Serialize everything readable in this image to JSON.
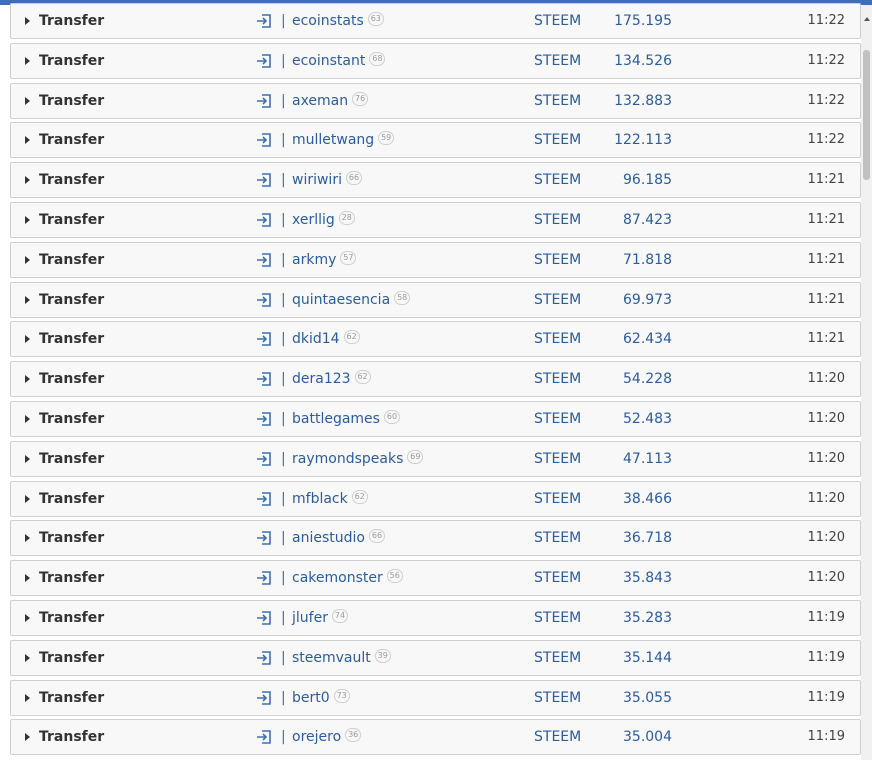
{
  "rows": [
    {
      "op": "Transfer",
      "user": "ecoinstats",
      "rep": "63",
      "asset": "STEEM",
      "amount": "175.195",
      "time": "11:22"
    },
    {
      "op": "Transfer",
      "user": "ecoinstant",
      "rep": "68",
      "asset": "STEEM",
      "amount": "134.526",
      "time": "11:22"
    },
    {
      "op": "Transfer",
      "user": "axeman",
      "rep": "76",
      "asset": "STEEM",
      "amount": "132.883",
      "time": "11:22"
    },
    {
      "op": "Transfer",
      "user": "mulletwang",
      "rep": "59",
      "asset": "STEEM",
      "amount": "122.113",
      "time": "11:22"
    },
    {
      "op": "Transfer",
      "user": "wiriwiri",
      "rep": "66",
      "asset": "STEEM",
      "amount": "96.185",
      "time": "11:21"
    },
    {
      "op": "Transfer",
      "user": "xerllig",
      "rep": "28",
      "asset": "STEEM",
      "amount": "87.423",
      "time": "11:21"
    },
    {
      "op": "Transfer",
      "user": "arkmy",
      "rep": "57",
      "asset": "STEEM",
      "amount": "71.818",
      "time": "11:21"
    },
    {
      "op": "Transfer",
      "user": "quintaesencia",
      "rep": "58",
      "asset": "STEEM",
      "amount": "69.973",
      "time": "11:21"
    },
    {
      "op": "Transfer",
      "user": "dkid14",
      "rep": "62",
      "asset": "STEEM",
      "amount": "62.434",
      "time": "11:21"
    },
    {
      "op": "Transfer",
      "user": "dera123",
      "rep": "62",
      "asset": "STEEM",
      "amount": "54.228",
      "time": "11:20"
    },
    {
      "op": "Transfer",
      "user": "battlegames",
      "rep": "60",
      "asset": "STEEM",
      "amount": "52.483",
      "time": "11:20"
    },
    {
      "op": "Transfer",
      "user": "raymondspeaks",
      "rep": "69",
      "asset": "STEEM",
      "amount": "47.113",
      "time": "11:20"
    },
    {
      "op": "Transfer",
      "user": "mfblack",
      "rep": "62",
      "asset": "STEEM",
      "amount": "38.466",
      "time": "11:20"
    },
    {
      "op": "Transfer",
      "user": "aniestudio",
      "rep": "66",
      "asset": "STEEM",
      "amount": "36.718",
      "time": "11:20"
    },
    {
      "op": "Transfer",
      "user": "cakemonster",
      "rep": "56",
      "asset": "STEEM",
      "amount": "35.843",
      "time": "11:20"
    },
    {
      "op": "Transfer",
      "user": "jlufer",
      "rep": "74",
      "asset": "STEEM",
      "amount": "35.283",
      "time": "11:19"
    },
    {
      "op": "Transfer",
      "user": "steemvault",
      "rep": "39",
      "asset": "STEEM",
      "amount": "35.144",
      "time": "11:19"
    },
    {
      "op": "Transfer",
      "user": "bert0",
      "rep": "73",
      "asset": "STEEM",
      "amount": "35.055",
      "time": "11:19"
    },
    {
      "op": "Transfer",
      "user": "orejero",
      "rep": "36",
      "asset": "STEEM",
      "amount": "35.004",
      "time": "11:19"
    }
  ],
  "icons": {
    "expand": "caret-right-icon",
    "direction": "sign-in-icon"
  },
  "colors": {
    "accent": "#3d6fb6",
    "link": "#2a5c9e",
    "row_bg": "#f8f8f8",
    "row_border": "#d0d0d0"
  }
}
